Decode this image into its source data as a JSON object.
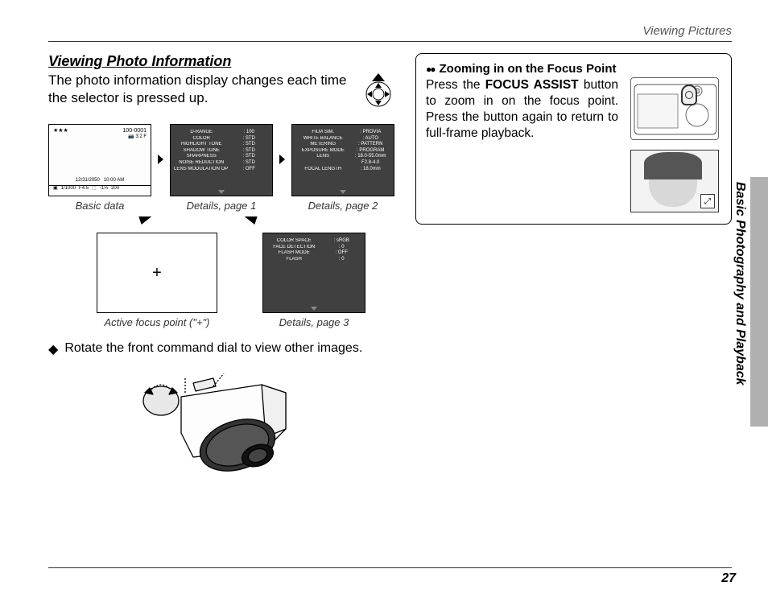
{
  "header": {
    "section": "Viewing Pictures"
  },
  "sideTab": {
    "label": "Basic Photography and Playback"
  },
  "pageNumber": "27",
  "left": {
    "title": "Viewing Photo Information",
    "intro": "The photo information display changes each time the selector is pressed up.",
    "caption_basic": "Basic data",
    "caption_d1": "Details, page 1",
    "caption_d2": "Details, page 2",
    "caption_fp": "Active focus point (\"+\")",
    "caption_d3": "Details, page 3",
    "noteBullet": "◆",
    "noteText": "Rotate the front command dial to view other images.",
    "basic": {
      "stars": "★★★",
      "frame": "100-0001",
      "aspectSize": "3:2 F",
      "date": "12/31/2050",
      "time": "10:00 AM",
      "shutter": "1/1000",
      "aperture": "F4.5",
      "exp": "-1⅓",
      "iso": "200"
    },
    "details1": [
      {
        "k": "D-RANGE",
        "v": ": 100"
      },
      {
        "k": "COLOR",
        "v": ": STD"
      },
      {
        "k": "HIGHLIGHT TONE",
        "v": ": STD"
      },
      {
        "k": "SHADOW TONE",
        "v": ": STD"
      },
      {
        "k": "SHARPNESS",
        "v": ": STD"
      },
      {
        "k": "NOISE REDUCTION",
        "v": ": STD"
      },
      {
        "k": "LENS MODULATION OPT.",
        "v": ": OFF"
      }
    ],
    "details2": [
      {
        "k": "FILM SIM.",
        "v": ": PROVIA"
      },
      {
        "k": "WHITE BALANCE",
        "v": ": AUTO"
      },
      {
        "k": "METERING",
        "v": ": PATTERN"
      },
      {
        "k": "EXPOSURE MODE",
        "v": ": PROGRAM"
      },
      {
        "k": "LENS",
        "v": ": 18.0-55.0mm"
      },
      {
        "k": "",
        "v": "  F2.8-4.0"
      },
      {
        "k": "FOCAL LENGTH",
        "v": ": 18.0mm"
      }
    ],
    "details3": [
      {
        "k": "COLOR SPACE",
        "v": ": sRGB"
      },
      {
        "k": "FACE DETECTION",
        "v": ": 0"
      },
      {
        "k": "FLASH MODE",
        "v": ": OFF"
      },
      {
        "k": "FLASH",
        "v": ": 0"
      }
    ],
    "fpMark": "+"
  },
  "right": {
    "iconAlt": "playback-zoom-icon",
    "title": "Zooming in on the Focus Point",
    "text_pre": "Press the ",
    "text_btn": "FOCUS ASSIST",
    "text_post": " button to zoom in on the focus point.  Press the button again to return to full-frame playback.",
    "zoomBadge": "⤢"
  }
}
